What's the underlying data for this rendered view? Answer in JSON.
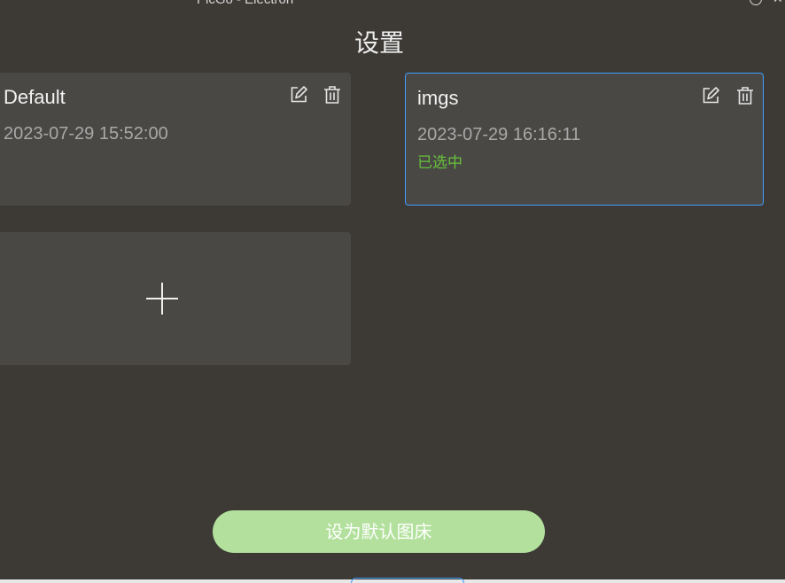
{
  "window": {
    "title": "PicGo - Electron"
  },
  "page": {
    "title": "设置"
  },
  "configs": [
    {
      "name": "Default",
      "date": "2023-07-29 15:52:00",
      "status": ""
    },
    {
      "name": "imgs",
      "date": "2023-07-29 16:16:11",
      "status": "已选中"
    }
  ],
  "icons": {
    "edit": "edit-icon",
    "delete": "trash-icon",
    "add": "plus-icon",
    "help": "help-icon"
  },
  "actions": {
    "set_default_label": "设为默认图床"
  },
  "colors": {
    "background": "#3d3a36",
    "card": "#494845",
    "selected_border": "#409eff",
    "selected_text": "#67c23a",
    "primary_button": "#b3e19d"
  }
}
